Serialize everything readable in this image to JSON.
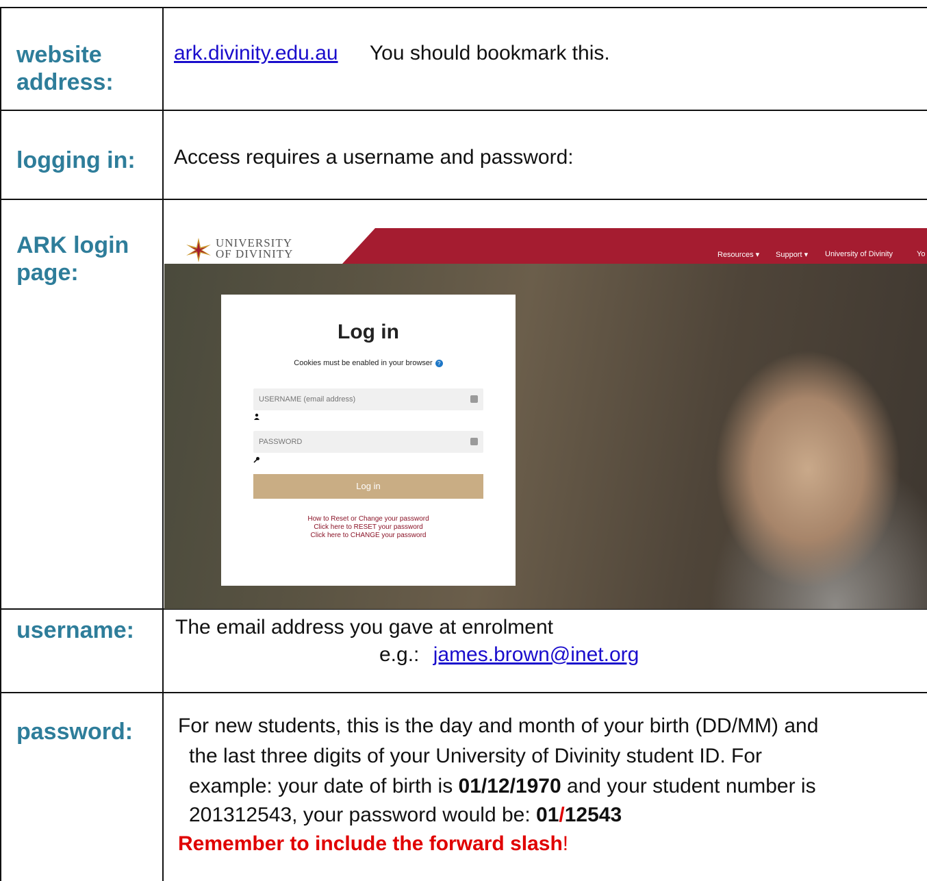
{
  "rows": {
    "website": {
      "label": "website address:",
      "link_text": "ark.divinity.edu.au",
      "note": "You should bookmark this."
    },
    "logging_in": {
      "label": "logging in:",
      "text": "Access requires a username and password:"
    },
    "ark_login": {
      "label": "ARK login page:"
    },
    "username": {
      "label": "username:",
      "text": "The email address you gave at enrolment",
      "example_prefix": "e.g.:",
      "example_link": "james.brown@inet.org"
    },
    "password": {
      "label": "password:",
      "line1": "For new students, this is the day and month of your birth (DD/MM) and",
      "line2": "the last three digits of your University of Divinity student ID. For",
      "line3_a": "example:  your date of birth is ",
      "line3_bold": "01/12/1970",
      "line3_b": " and your student number is",
      "line4_a": "201312543, your password would be:  ",
      "line4_bold_1": "01",
      "line4_slash": "/",
      "line4_bold_2": "12543",
      "reminder": "Remember to include the forward slash",
      "reminder_end": "!"
    }
  },
  "screenshot": {
    "logo_line1": "UNIVERSITY",
    "logo_line2": "OF DIVINITY",
    "nav": [
      "Resources",
      "Support",
      "University of Divinity",
      "Yo"
    ],
    "card": {
      "title": "Log in",
      "cookies": "Cookies must be enabled in your browser",
      "username_placeholder": "USERNAME (email address)",
      "password_placeholder": "PASSWORD",
      "button": "Log in",
      "links": [
        "How to Reset or Change your password",
        "Click here to RESET your password",
        "Click here to CHANGE your password"
      ]
    }
  },
  "colors": {
    "label": "#2e7d9a",
    "link": "#1a0dcc",
    "red": "#e00000",
    "brand_red": "#a51c30",
    "button": "#c9ad84"
  }
}
